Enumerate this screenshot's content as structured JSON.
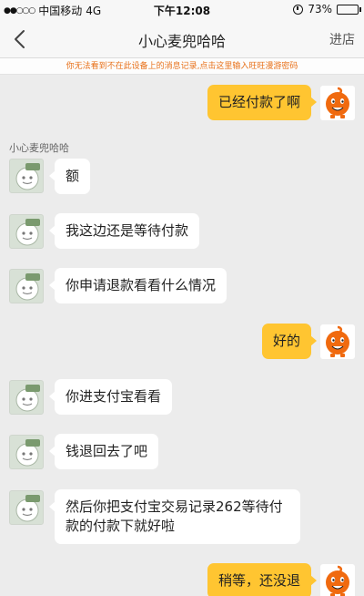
{
  "status_bar": {
    "signal": "●●○○○",
    "carrier": "中国移动",
    "network": "4G",
    "time": "下午12:08",
    "battery_percent": "73%",
    "battery_level": 0.73
  },
  "nav": {
    "title": "小心麦兜哈哈",
    "right_action": "进店"
  },
  "notice": "你无法看到不在此设备上的消息记录,点击这里输入旺旺漫游密码",
  "sender_name": "小心麦兜哈哈",
  "messages": [
    {
      "side": "right",
      "text": "已经付款了啊"
    },
    {
      "side": "left",
      "text": "额"
    },
    {
      "side": "left",
      "text": "我这边还是等待付款"
    },
    {
      "side": "left",
      "text": "你申请退款看看什么情况"
    },
    {
      "side": "right",
      "text": "好的"
    },
    {
      "side": "left",
      "text": "你进支付宝看看"
    },
    {
      "side": "left",
      "text": "钱退回去了吧"
    },
    {
      "side": "left",
      "lines": [
        "然后你把支付宝交易记录262等待付",
        "款的付款下就好啦"
      ]
    },
    {
      "side": "right",
      "text": "稍等，还没退"
    }
  ],
  "colors": {
    "my_bubble": "#ffc531",
    "their_bubble": "#ffffff",
    "notice_text": "#e8721c",
    "background": "#ececec"
  },
  "icons": {
    "back": "chevron-left-icon",
    "my_avatar": "orange-mascot-avatar",
    "store_avatar": "store-logo-avatar"
  }
}
